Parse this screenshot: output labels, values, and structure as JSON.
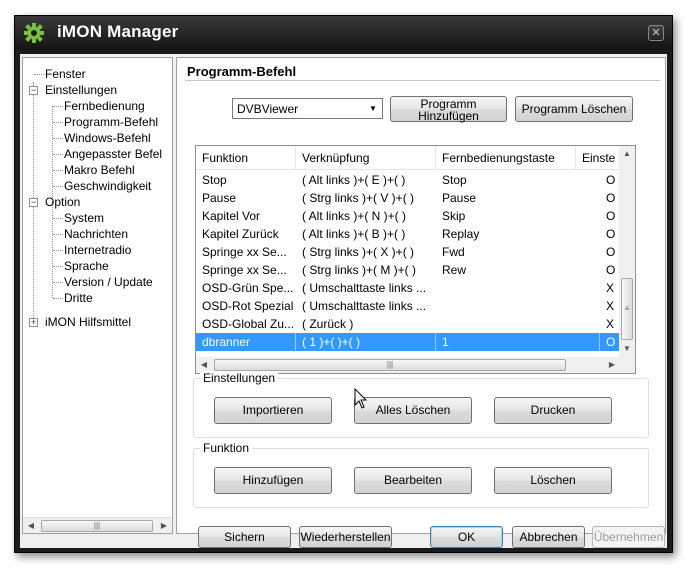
{
  "window": {
    "title": "iMON Manager",
    "app_icon": "gear-icon",
    "close_icon": "close-icon"
  },
  "tree": {
    "items": [
      {
        "label": "Fenster",
        "level": 1,
        "expander": ""
      },
      {
        "label": "Einstellungen",
        "level": 0,
        "expander": "−"
      },
      {
        "label": "Fernbedienung",
        "level": 2,
        "expander": ""
      },
      {
        "label": "Programm-Befehl",
        "level": 2,
        "expander": ""
      },
      {
        "label": "Windows-Befehl",
        "level": 2,
        "expander": ""
      },
      {
        "label": "Angepasster Befel",
        "level": 2,
        "expander": ""
      },
      {
        "label": "Makro  Befehl",
        "level": 2,
        "expander": ""
      },
      {
        "label": "Geschwindigkeit",
        "level": 2,
        "expander": ""
      },
      {
        "label": "Option",
        "level": 0,
        "expander": "−"
      },
      {
        "label": "System",
        "level": 2,
        "expander": ""
      },
      {
        "label": "Nachrichten",
        "level": 2,
        "expander": ""
      },
      {
        "label": "Internetradio",
        "level": 2,
        "expander": ""
      },
      {
        "label": "Sprache",
        "level": 2,
        "expander": ""
      },
      {
        "label": "Version / Update",
        "level": 2,
        "expander": ""
      },
      {
        "label": "Dritte",
        "level": 2,
        "expander": ""
      },
      {
        "label": "iMON Hilfsmittel",
        "level": 0,
        "expander": "+"
      }
    ]
  },
  "main": {
    "section_title": "Programm-Befehl",
    "program_select": {
      "value": "DVBViewer"
    },
    "add_program_button": {
      "line1": "Programm",
      "line2": "Hinzufügen"
    },
    "delete_program_button": "Programm Löschen",
    "table": {
      "columns": [
        "Funktion",
        "Verknüpfung",
        "Fernbedienungstaste",
        "Einste"
      ],
      "rows": [
        [
          "Stop",
          "( Alt links )+( E )+(  )",
          "Stop",
          "O"
        ],
        [
          "Pause",
          "( Strg links )+( V )+(  )",
          "Pause",
          "O"
        ],
        [
          "Kapitel Vor",
          "( Alt links )+( N )+(  )",
          "Skip",
          "O"
        ],
        [
          "Kapitel Zurück",
          "( Alt links )+( B )+(  )",
          "Replay",
          "O"
        ],
        [
          "Springe xx Se...",
          "( Strg links )+( X )+(  )",
          "Fwd",
          "O"
        ],
        [
          "Springe xx Se...",
          "( Strg links )+( M )+(  )",
          "Rew",
          "O"
        ],
        [
          "OSD-Grün Spe...",
          "( Umschalttaste links ...",
          "",
          "X"
        ],
        [
          "OSD-Rot Spezial",
          "( Umschalttaste links ...",
          "",
          "X"
        ],
        [
          "OSD-Global Zu...",
          "( Zurück )",
          "",
          "X"
        ],
        [
          "dbranner",
          "( 1 )+(  )+(  )",
          "1",
          "O"
        ]
      ],
      "selected_row": 9
    },
    "settings_group": {
      "label": "Einstellungen",
      "import_button": "Importieren",
      "clear_all_button": "Alles Löschen",
      "print_button": "Drucken"
    },
    "function_group": {
      "label": "Funktion",
      "add_button": "Hinzufügen",
      "edit_button": "Bearbeiten",
      "delete_button": "Löschen"
    }
  },
  "footer": {
    "save_button": "Sichern",
    "restore_button": "Wiederherstellen",
    "ok_button": "OK",
    "cancel_button": "Abbrechen",
    "apply_button": "Übernehmen"
  },
  "colors": {
    "titlebar": "#1b1b1b",
    "selection": "#3399ff",
    "icon_green": "#7ac142"
  }
}
